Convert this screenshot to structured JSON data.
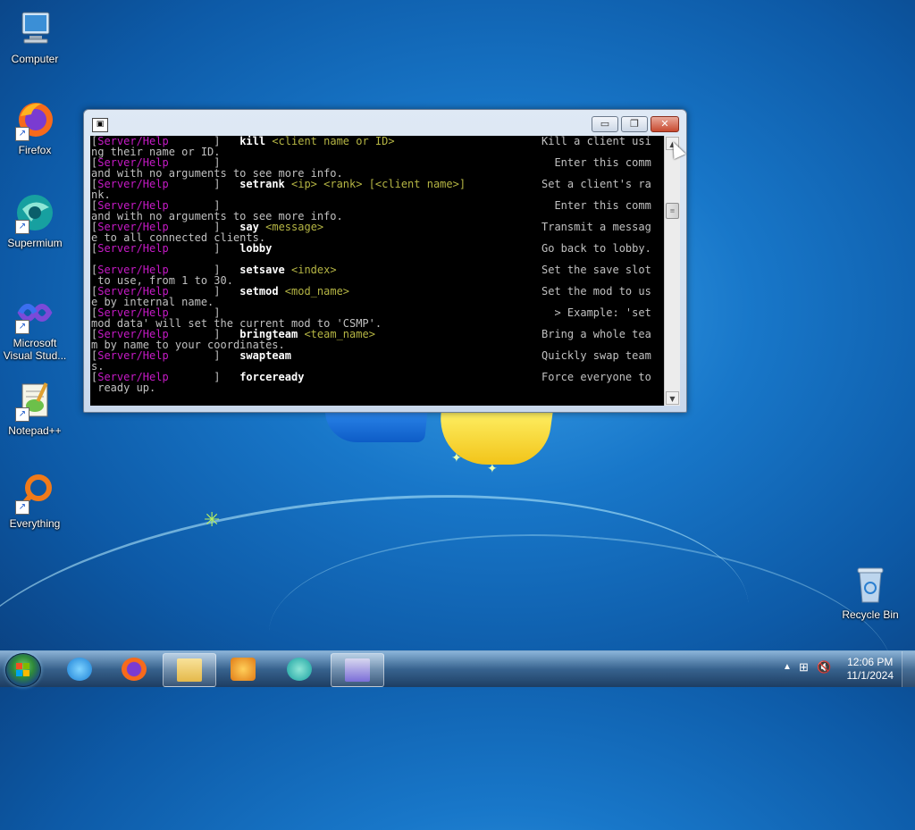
{
  "desktop": {
    "icons": [
      {
        "label": "Computer"
      },
      {
        "label": "Firefox"
      },
      {
        "label": "Supermium"
      },
      {
        "label": "Microsoft Visual Stud..."
      },
      {
        "label": "Notepad++"
      },
      {
        "label": "Everything"
      },
      {
        "label": "Recycle Bin"
      }
    ]
  },
  "console": {
    "lines": [
      {
        "tag": "[",
        "role": "Server/Help",
        "close": "       ]   ",
        "cmd": "kill",
        "args": " <client name or ID>",
        "desc": "Kill a client usi"
      },
      {
        "text": "ng their name or ID."
      },
      {
        "tag": "[",
        "role": "Server/Help",
        "close": "       ]",
        "cmd": "",
        "args": "",
        "desc": "  Enter this comm"
      },
      {
        "text": "and with no arguments to see more info."
      },
      {
        "tag": "[",
        "role": "Server/Help",
        "close": "       ]   ",
        "cmd": "setrank",
        "args": " <ip> <rank> [<client name>]",
        "desc": "Set a client's ra"
      },
      {
        "text": "nk."
      },
      {
        "tag": "[",
        "role": "Server/Help",
        "close": "       ]",
        "cmd": "",
        "args": "",
        "desc": "  Enter this comm"
      },
      {
        "text": "and with no arguments to see more info."
      },
      {
        "tag": "[",
        "role": "Server/Help",
        "close": "       ]   ",
        "cmd": "say",
        "args": " <message>",
        "desc": "Transmit a messag"
      },
      {
        "text": "e to all connected clients."
      },
      {
        "tag": "[",
        "role": "Server/Help",
        "close": "       ]   ",
        "cmd": "lobby",
        "args": "",
        "desc": "Go back to lobby."
      },
      {
        "text": ""
      },
      {
        "tag": "[",
        "role": "Server/Help",
        "close": "       ]   ",
        "cmd": "setsave",
        "args": " <index>",
        "desc": "Set the save slot"
      },
      {
        "text": " to use, from 1 to 30."
      },
      {
        "tag": "[",
        "role": "Server/Help",
        "close": "       ]   ",
        "cmd": "setmod",
        "args": " <mod_name>",
        "desc": "Set the mod to us"
      },
      {
        "text": "e by internal name."
      },
      {
        "tag": "[",
        "role": "Server/Help",
        "close": "       ]",
        "cmd": "",
        "args": "",
        "desc": "  > Example: 'set"
      },
      {
        "text": "mod data' will set the current mod to 'CSMP'."
      },
      {
        "tag": "[",
        "role": "Server/Help",
        "close": "       ]   ",
        "cmd": "bringteam",
        "args": " <team_name>",
        "desc": "Bring a whole tea"
      },
      {
        "text": "m by name to your coordinates."
      },
      {
        "tag": "[",
        "role": "Server/Help",
        "close": "       ]   ",
        "cmd": "swapteam",
        "args": "",
        "desc": "Quickly swap team"
      },
      {
        "text": "s."
      },
      {
        "tag": "[",
        "role": "Server/Help",
        "close": "       ]   ",
        "cmd": "forceready",
        "args": "",
        "desc": "Force everyone to"
      },
      {
        "text": " ready up."
      }
    ]
  },
  "taskbar": {
    "apps": [
      "internet-explorer-icon",
      "firefox-icon",
      "file-explorer-icon",
      "media-player-icon",
      "supermium-icon",
      "console-app-icon"
    ],
    "clock_time": "12:06 PM",
    "clock_date": "11/1/2024"
  },
  "colors": {
    "console_bg": "#000000",
    "console_text": "#c0c0c0",
    "tag_magenta": "#c61ac6",
    "arg_olive": "#b5b544"
  }
}
